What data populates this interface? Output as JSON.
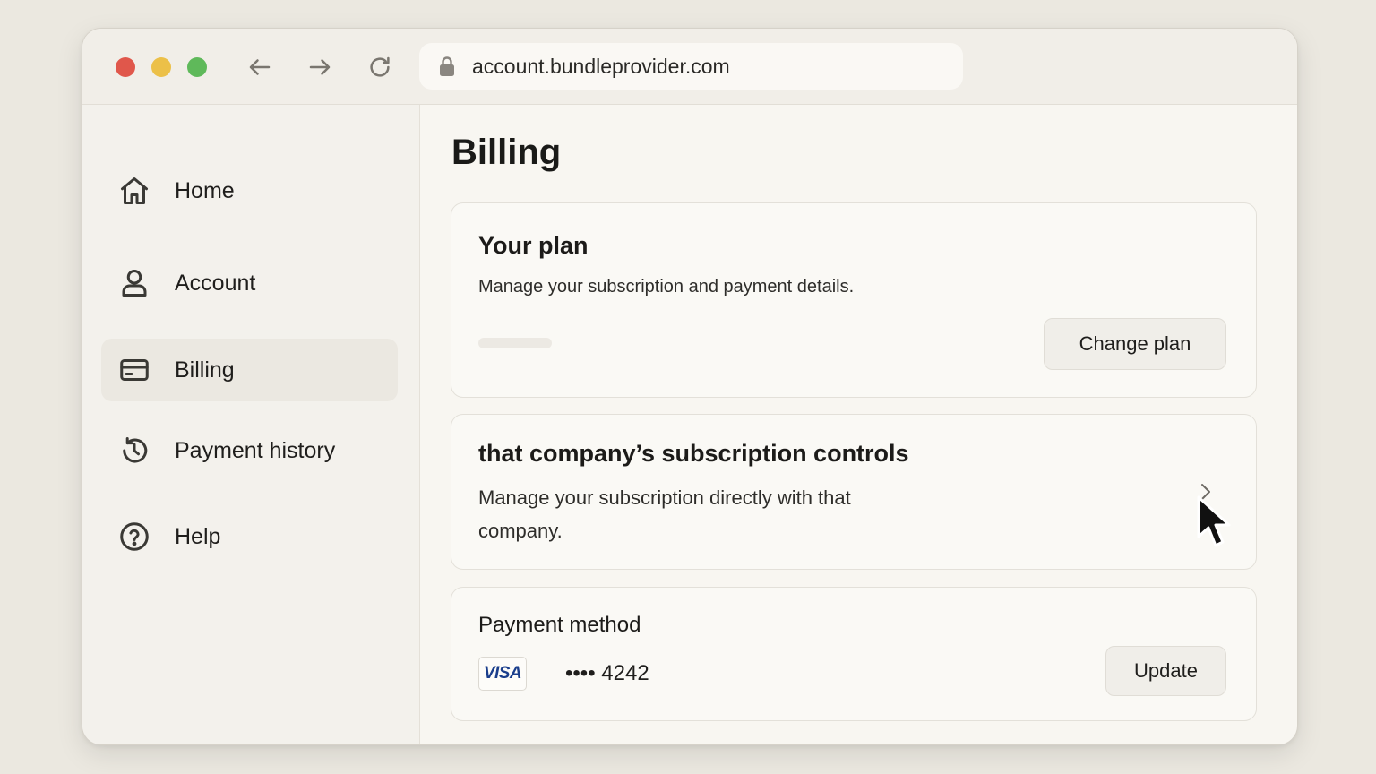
{
  "browser": {
    "url": "account.bundleprovider.com",
    "icons": {
      "back": "arrow-left-icon",
      "forward": "arrow-right-icon",
      "reload": "reload-icon",
      "lock": "lock-icon"
    }
  },
  "sidebar": {
    "items": [
      {
        "label": "Home",
        "icon": "home-icon",
        "active": false
      },
      {
        "label": "Account",
        "icon": "user-icon",
        "active": false
      },
      {
        "label": "Billing",
        "icon": "credit-card-icon",
        "active": true
      },
      {
        "label": "Payment history",
        "icon": "history-icon",
        "active": false
      },
      {
        "label": "Help",
        "icon": "help-circle-icon",
        "active": false
      }
    ]
  },
  "main": {
    "title": "Billing",
    "plan_card": {
      "title": "Your plan",
      "description": "Manage your subscription and payment details.",
      "button_label": "Change plan"
    },
    "company_card": {
      "title": "that company’s subscription controls",
      "description": "Manage your subscription directly with that company."
    },
    "payment_card": {
      "title": "Payment method",
      "card_brand": "VISA",
      "card_number": "•••• 4242",
      "button_label": "Update"
    }
  },
  "colors": {
    "traffic_red": "#e0574b",
    "traffic_yellow": "#ecc048",
    "traffic_green": "#5fb95a",
    "visa_blue": "#1a3e8c",
    "active_nav_bg": "#ebe8e1"
  }
}
